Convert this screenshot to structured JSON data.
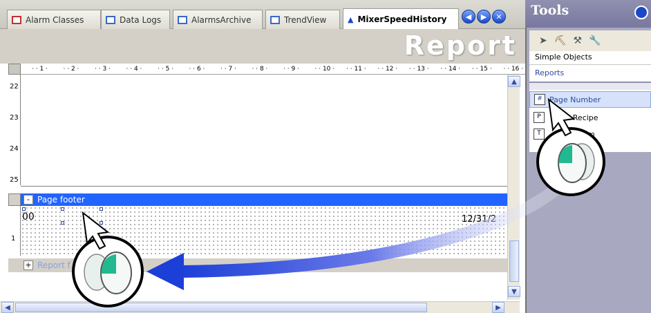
{
  "tabs": [
    {
      "label": "Alarm Classes"
    },
    {
      "label": "Data Logs"
    },
    {
      "label": "AlarmsArchive"
    },
    {
      "label": "TrendView"
    },
    {
      "label": "MixerSpeedHistory",
      "active": true
    }
  ],
  "header": {
    "title": "Report"
  },
  "ruler": {
    "ticks": [
      "1",
      "2",
      "3",
      "4",
      "5",
      "6",
      "7",
      "8",
      "9",
      "10",
      "11",
      "12",
      "13",
      "14",
      "15",
      "16"
    ]
  },
  "vruler": {
    "ticks": [
      "22",
      "23",
      "24",
      "25"
    ]
  },
  "footer": {
    "label": "Page footer",
    "toggle": "-",
    "text": "00",
    "date": "12/31/2"
  },
  "report_section": {
    "label": "Report f",
    "toggle": "+"
  },
  "tools": {
    "title": "Tools",
    "simple_objects": "Simple Objects",
    "reports": "Reports",
    "items": [
      {
        "label": "Page Number",
        "icon": "#"
      },
      {
        "label": "nt Recipe",
        "icon": "P"
      },
      {
        "label": "m",
        "icon": "T"
      }
    ]
  },
  "colors": {
    "accent": "#2264ff",
    "arrow": "#1c3fd8"
  }
}
